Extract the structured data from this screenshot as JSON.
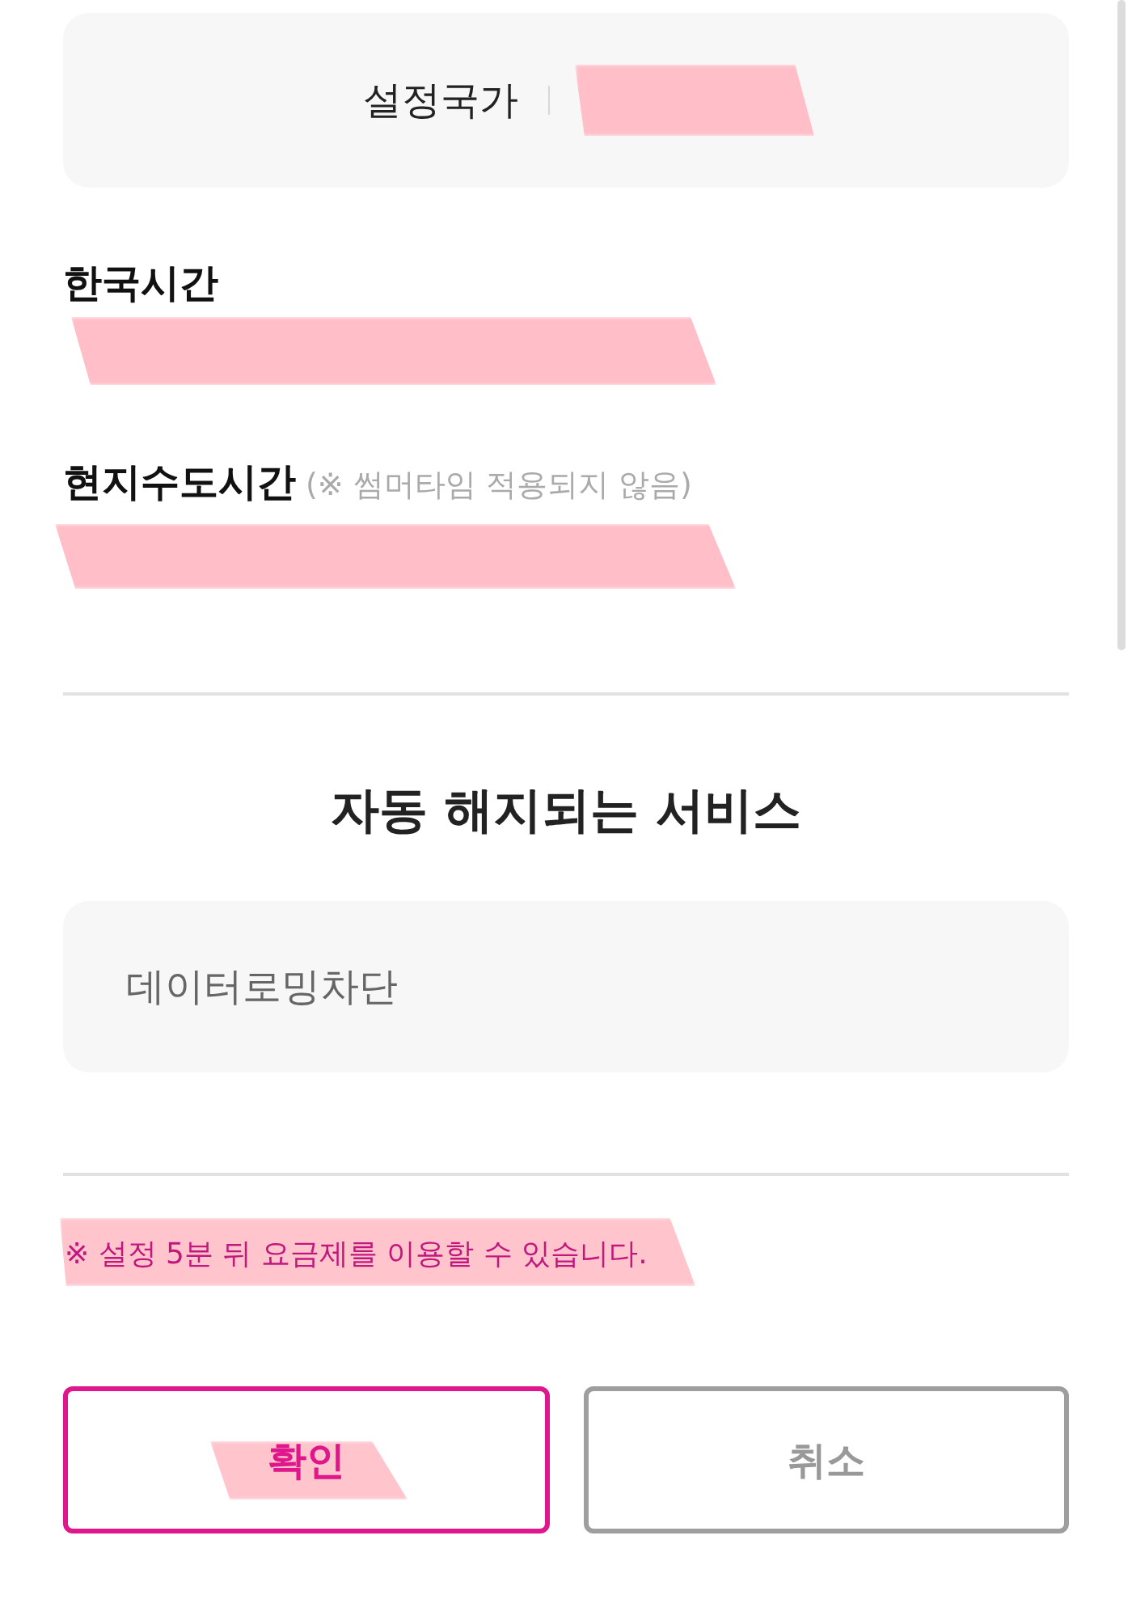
{
  "country_card": {
    "label": "설정국가",
    "value_redacted": true
  },
  "time_fields": [
    {
      "label": "한국시간",
      "redacted": true
    },
    {
      "label": "현지수도시간",
      "note": "(※ 썸머타임 적용되지 않음)",
      "redacted": true
    }
  ],
  "services": {
    "title": "자동 해지되는 서비스",
    "items": [
      "데이터로밍차단"
    ]
  },
  "notice": {
    "text": "※ 설정 5분 뒤 요금제를 이용할 수 있습니다.",
    "highlighted": true
  },
  "buttons": [
    {
      "label": "확인",
      "kind": "primary",
      "highlighted": true
    },
    {
      "label": "취소",
      "kind": "secondary",
      "highlighted": false
    }
  ]
}
